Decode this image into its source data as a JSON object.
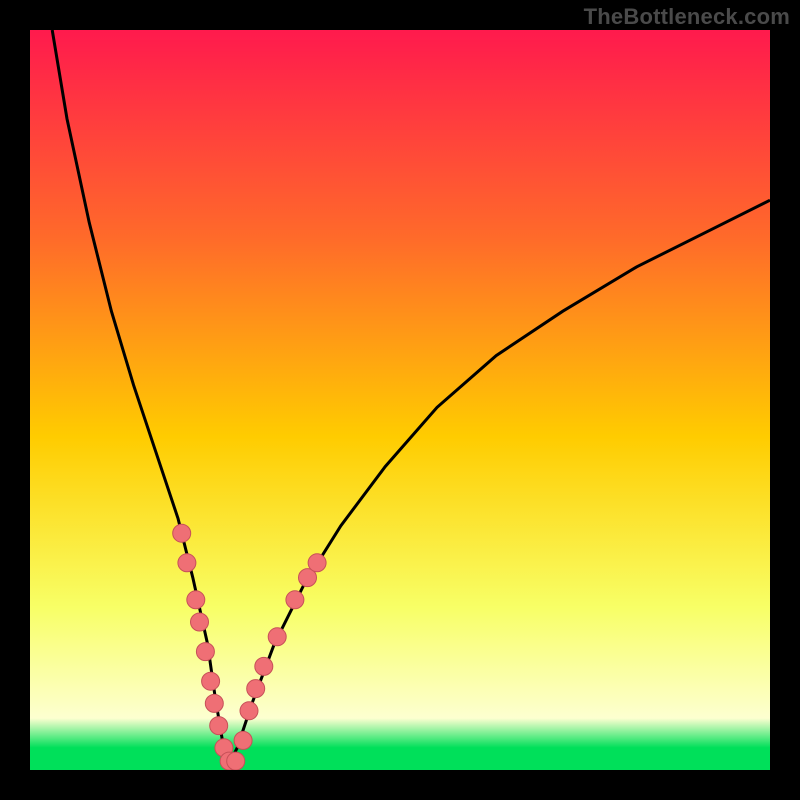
{
  "watermark": "TheBottleneck.com",
  "colors": {
    "frame": "#000000",
    "gradient_top": "#ff1a4d",
    "gradient_upper_mid": "#ff6a2a",
    "gradient_mid": "#ffcc00",
    "gradient_lower_mid": "#f8ff66",
    "gradient_pale": "#fdffd0",
    "gradient_green": "#00e05a",
    "curve": "#000000",
    "dot_fill": "#ef6f75",
    "dot_stroke": "#c75058"
  },
  "chart_data": {
    "type": "line",
    "title": "",
    "xlabel": "",
    "ylabel": "",
    "xlim": [
      0,
      100
    ],
    "ylim": [
      0,
      100
    ],
    "series": [
      {
        "name": "bottleneck-curve",
        "x": [
          3,
          5,
          8,
          11,
          14,
          17,
          20,
          22,
          24,
          25,
          26,
          27,
          28,
          30,
          33,
          37,
          42,
          48,
          55,
          63,
          72,
          82,
          92,
          100
        ],
        "y": [
          100,
          88,
          74,
          62,
          52,
          43,
          34,
          26,
          17,
          10,
          4,
          1,
          3,
          9,
          17,
          25,
          33,
          41,
          49,
          56,
          62,
          68,
          73,
          77
        ]
      }
    ],
    "points": [
      {
        "name": "dot",
        "x": 20.5,
        "y": 32
      },
      {
        "name": "dot",
        "x": 21.2,
        "y": 28
      },
      {
        "name": "dot",
        "x": 22.4,
        "y": 23
      },
      {
        "name": "dot",
        "x": 22.9,
        "y": 20
      },
      {
        "name": "dot",
        "x": 23.7,
        "y": 16
      },
      {
        "name": "dot",
        "x": 24.4,
        "y": 12
      },
      {
        "name": "dot",
        "x": 24.9,
        "y": 9
      },
      {
        "name": "dot",
        "x": 25.5,
        "y": 6
      },
      {
        "name": "dot",
        "x": 26.2,
        "y": 3
      },
      {
        "name": "dot",
        "x": 26.9,
        "y": 1.2
      },
      {
        "name": "dot",
        "x": 27.8,
        "y": 1.2
      },
      {
        "name": "dot",
        "x": 28.8,
        "y": 4
      },
      {
        "name": "dot",
        "x": 29.6,
        "y": 8
      },
      {
        "name": "dot",
        "x": 30.5,
        "y": 11
      },
      {
        "name": "dot",
        "x": 31.6,
        "y": 14
      },
      {
        "name": "dot",
        "x": 33.4,
        "y": 18
      },
      {
        "name": "dot",
        "x": 35.8,
        "y": 23
      },
      {
        "name": "dot",
        "x": 37.5,
        "y": 26
      },
      {
        "name": "dot",
        "x": 38.8,
        "y": 28
      }
    ],
    "green_band_y": [
      0,
      3
    ]
  }
}
